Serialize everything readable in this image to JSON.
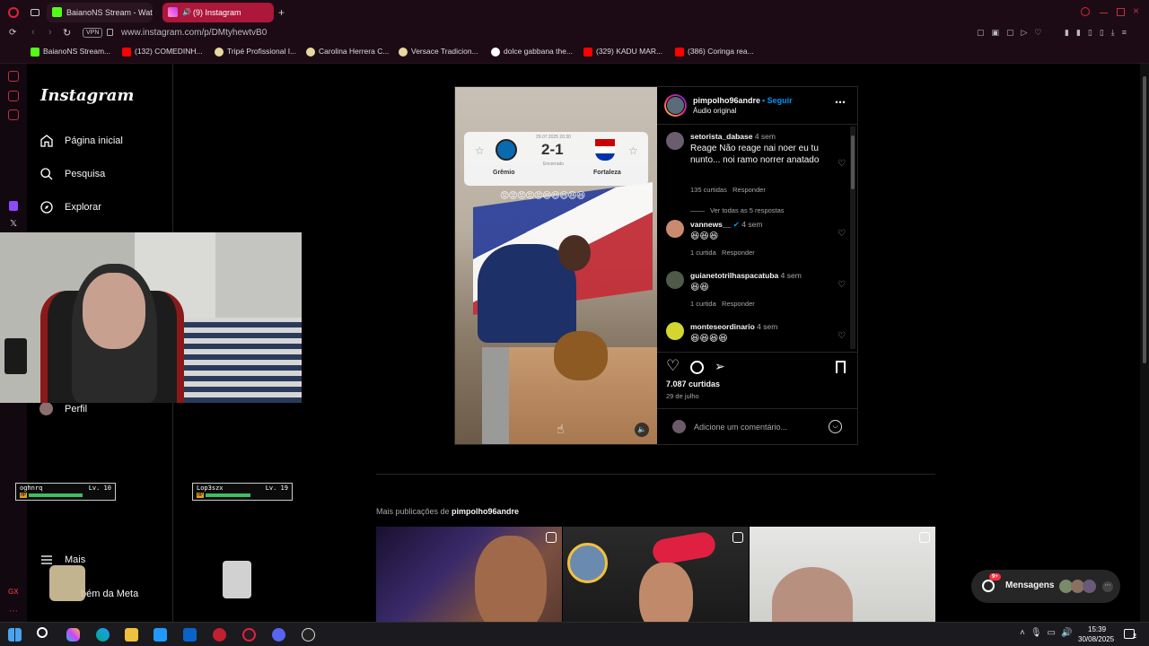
{
  "browser": {
    "tabs": [
      {
        "title": "BaianoNS Stream - Watch",
        "active": false
      },
      {
        "title": "(9) Instagram",
        "active": true
      }
    ],
    "address": "www.instagram.com/p/DMtyhewtvB0",
    "vpn_label": "VPN",
    "bookmarks": [
      "BaianoNS Stream...",
      "(132) COMEDINH...",
      "Tripé Profissional I...",
      "Carolina Herrera C...",
      "Versace Tradicion...",
      "dolce gabbana the...",
      "(329) KADU MAR...",
      "(386) Coringa rea..."
    ]
  },
  "instagram": {
    "logo": "Instagram",
    "nav": {
      "home": "Página inicial",
      "search": "Pesquisa",
      "explore": "Explorar",
      "profile": "Perfil",
      "more": "Mais",
      "meta": "bém da Meta"
    },
    "post": {
      "username": "pimpolho96andre",
      "follow": "• Seguir",
      "audio": "Áudio original",
      "scoreboard": {
        "date": "29.07.2025 20:30",
        "score": "2-1",
        "status": "Encerrado",
        "home": "Grêmio",
        "away": "Fortaleza",
        "emojis": "😡😡😡😡😡😆😆😆😆😆"
      },
      "likes": "7.087 curtidas",
      "date": "29 de julho",
      "comment_placeholder": "Adicione um comentário...",
      "comments": [
        {
          "user": "setorista_dabase",
          "time": "4 sem",
          "text": "Reage Não reage nai noer eu tu nunto... noi ramo norrer anatado",
          "likes": "135 curtidas",
          "reply": "Responder",
          "view_replies": "Ver todas as 5 respostas"
        },
        {
          "user": "vannews__",
          "time": "4 sem",
          "text": "😆😆😆",
          "likes": "1 curtida",
          "reply": "Responder",
          "verified": true
        },
        {
          "user": "guianetotrilhaspacatuba",
          "time": "4 sem",
          "text": "😆😆",
          "likes": "1 curtida",
          "reply": "Responder"
        },
        {
          "user": "monteseordinario",
          "time": "4 sem",
          "text": "😆😆😆😆",
          "likes": "",
          "reply": ""
        }
      ]
    },
    "more_posts_prefix": "Mais publicações de ",
    "more_posts_user": "pimpolho96andre",
    "messages": {
      "label": "Mensagens",
      "badge": "9+"
    }
  },
  "overlays": {
    "player1": {
      "name": "oghnrq",
      "level": "Lv. 10",
      "hp": "HP"
    },
    "player2": {
      "name": "Lop3szx",
      "level": "Lv. 19",
      "hp": "HP"
    }
  },
  "taskbar": {
    "time": "15:39",
    "date": "30/08/2025",
    "notif": "2"
  },
  "colors": {
    "accent_blue": "#0095f6",
    "opera_red": "#e0233d",
    "tab_active": "#ad1739"
  }
}
